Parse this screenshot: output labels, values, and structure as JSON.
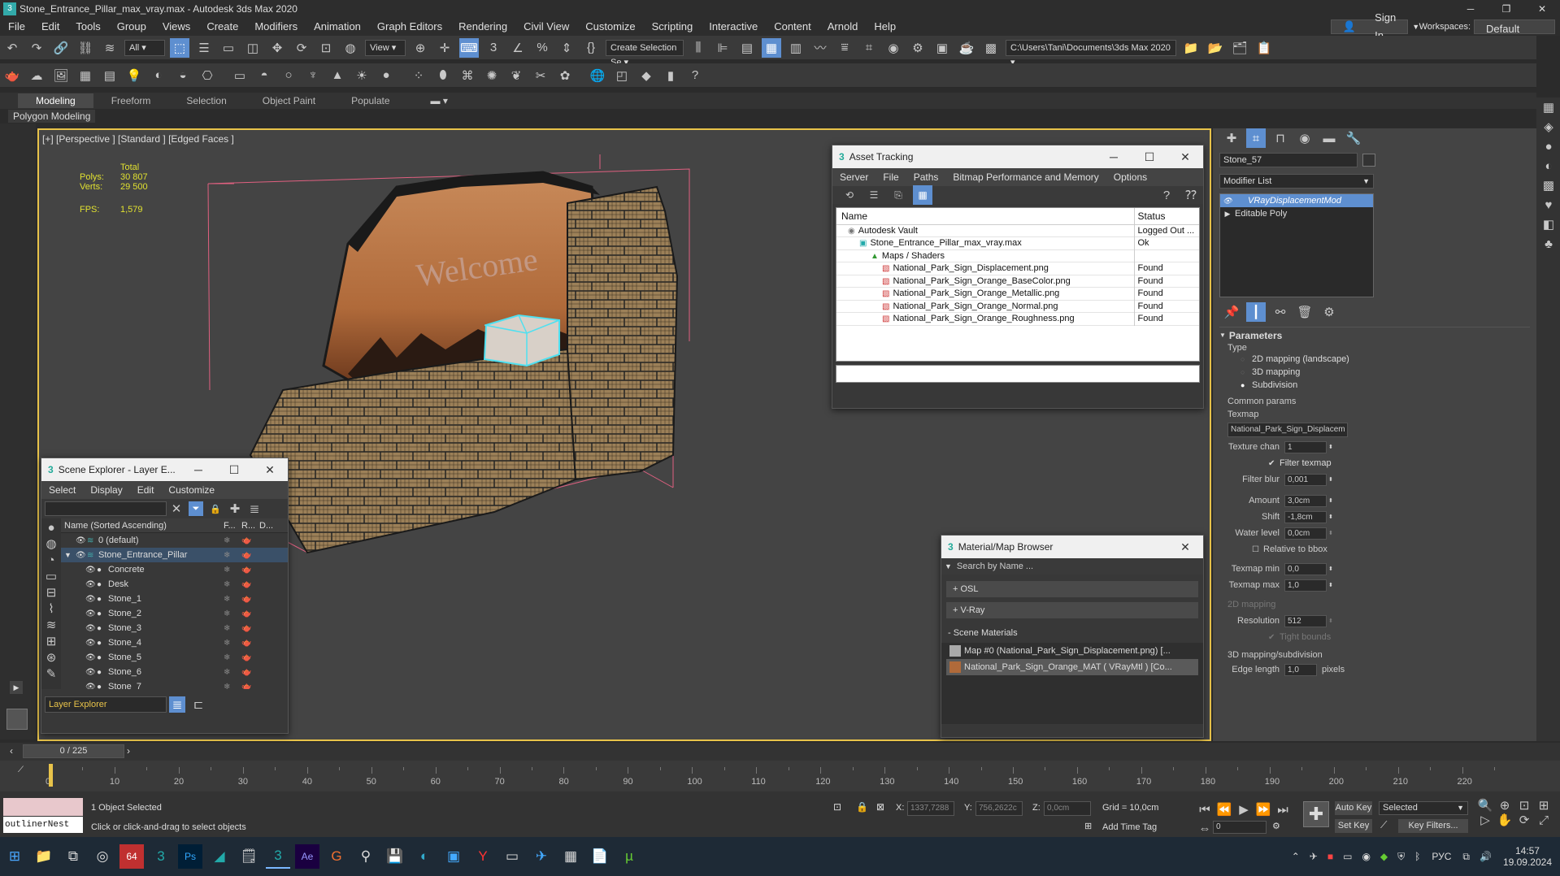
{
  "app": {
    "title": "Stone_Entrance_Pillar_max_vray.max - Autodesk 3ds Max 2020",
    "menu": [
      "File",
      "Edit",
      "Tools",
      "Group",
      "Views",
      "Create",
      "Modifiers",
      "Animation",
      "Graph Editors",
      "Rendering",
      "Civil View",
      "Customize",
      "Scripting",
      "Interactive",
      "Content",
      "Arnold",
      "Help"
    ],
    "sign_in": "Sign In",
    "workspaces_label": "Workspaces:",
    "workspace": "Default",
    "selection_filter": "All",
    "view_dropdown": "View",
    "create_selection_set": "Create Selection Se",
    "project_path": "C:\\Users\\Tani\\Documents\\3ds Max 2020"
  },
  "ribbon": {
    "tabs": [
      "Modeling",
      "Freeform",
      "Selection",
      "Object Paint",
      "Populate"
    ],
    "subtab": "Polygon Modeling"
  },
  "viewport": {
    "label": "[+] [Perspective ] [Standard ] [Edged Faces ]",
    "stats_total": "Total",
    "polys_label": "Polys:",
    "polys_value": "30 807",
    "verts_label": "Verts:",
    "verts_value": "29 500",
    "fps_label": "FPS:",
    "fps_value": "1,579",
    "sign_text": "Welcome"
  },
  "asset_tracking": {
    "title": "Asset Tracking",
    "menu": [
      "Server",
      "File",
      "Paths",
      "Bitmap Performance and Memory",
      "Options"
    ],
    "col_name": "Name",
    "col_status": "Status",
    "rows": [
      {
        "name": "Autodesk Vault",
        "status": "Logged Out ..."
      },
      {
        "name": "Stone_Entrance_Pillar_max_vray.max",
        "status": "Ok"
      },
      {
        "name": "Maps / Shaders",
        "status": ""
      },
      {
        "name": "National_Park_Sign_Displacement.png",
        "status": "Found"
      },
      {
        "name": "National_Park_Sign_Orange_BaseColor.png",
        "status": "Found"
      },
      {
        "name": "National_Park_Sign_Orange_Metallic.png",
        "status": "Found"
      },
      {
        "name": "National_Park_Sign_Orange_Normal.png",
        "status": "Found"
      },
      {
        "name": "National_Park_Sign_Orange_Roughness.png",
        "status": "Found"
      }
    ]
  },
  "scene_explorer": {
    "title": "Scene Explorer - Layer E...",
    "menu": [
      "Select",
      "Display",
      "Edit",
      "Customize"
    ],
    "col_name": "Name (Sorted Ascending)",
    "col_f": "F...",
    "col_r": "R...",
    "col_d": "D...",
    "items": [
      "0 (default)",
      "Stone_Entrance_Pillar",
      "Concrete",
      "Desk",
      "Stone_1",
      "Stone_2",
      "Stone_3",
      "Stone_4",
      "Stone_5",
      "Stone_6",
      "Stone_7"
    ],
    "footer": "Layer Explorer"
  },
  "material_browser": {
    "title": "Material/Map Browser",
    "search_placeholder": "Search by Name ...",
    "groups": [
      "+ OSL",
      "+ V-Ray"
    ],
    "scene_materials_label": "- Scene Materials",
    "materials": [
      "Map #0 (National_Park_Sign_Displacement.png) [...",
      "National_Park_Sign_Orange_MAT ( VRayMtl ) [Co..."
    ]
  },
  "command_panel": {
    "object_name": "Stone_57",
    "modifier_list": "Modifier List",
    "stack": [
      "VRayDisplacementMod",
      "Editable Poly"
    ],
    "parameters_title": "Parameters",
    "type_label": "Type",
    "type_options": [
      "2D mapping (landscape)",
      "3D mapping",
      "Subdivision"
    ],
    "common_params": "Common params",
    "texmap_label": "Texmap",
    "texmap_value": "National_Park_Sign_Displacem",
    "texture_chan_label": "Texture chan",
    "texture_chan_value": "1",
    "filter_texmap": "Filter texmap",
    "filter_blur_label": "Filter blur",
    "filter_blur_value": "0,001",
    "amount_label": "Amount",
    "amount_value": "3,0cm",
    "shift_label": "Shift",
    "shift_value": "-1,8cm",
    "water_level_label": "Water level",
    "water_level_value": "0,0cm",
    "relative_to_bbox": "Relative to bbox",
    "texmap_min_label": "Texmap min",
    "texmap_min_value": "0,0",
    "texmap_max_label": "Texmap max",
    "texmap_max_value": "1,0",
    "mapping_2d": "2D mapping",
    "resolution_label": "Resolution",
    "resolution_value": "512",
    "tight_bounds": "Tight bounds",
    "mapping_3d": "3D mapping/subdivision",
    "edge_length_label": "Edge length",
    "edge_length_value": "1,0",
    "edge_length_unit": "pixels"
  },
  "timeline": {
    "frame_counter": "0 / 225",
    "ticks": [
      "0",
      "10",
      "20",
      "30",
      "40",
      "50",
      "60",
      "70",
      "80",
      "90",
      "100",
      "110",
      "120",
      "130",
      "140",
      "150",
      "160",
      "170",
      "180",
      "190",
      "200",
      "210",
      "220"
    ]
  },
  "status": {
    "script_box": "outlinerNest",
    "selected": "1 Object Selected",
    "prompt": "Click or click-and-drag to select objects",
    "x_label": "X:",
    "x_value": "1337,7288",
    "y_label": "Y:",
    "y_value": "756,2622c",
    "z_label": "Z:",
    "z_value": "0,0cm",
    "grid": "Grid = 10,0cm",
    "add_time_tag": "Add Time Tag",
    "auto_key": "Auto Key",
    "set_key": "Set Key",
    "selected_dropdown": "Selected",
    "key_filters": "Key Filters...",
    "frame_value": "0"
  },
  "taskbar": {
    "lang": "РУС",
    "time": "14:57",
    "date": "19.09.2024"
  },
  "colors": {
    "accent": "#5e8fd0",
    "viewport_bg": "#444444",
    "panel_bg": "#444444",
    "selection_cyan": "#4fe0f0"
  }
}
